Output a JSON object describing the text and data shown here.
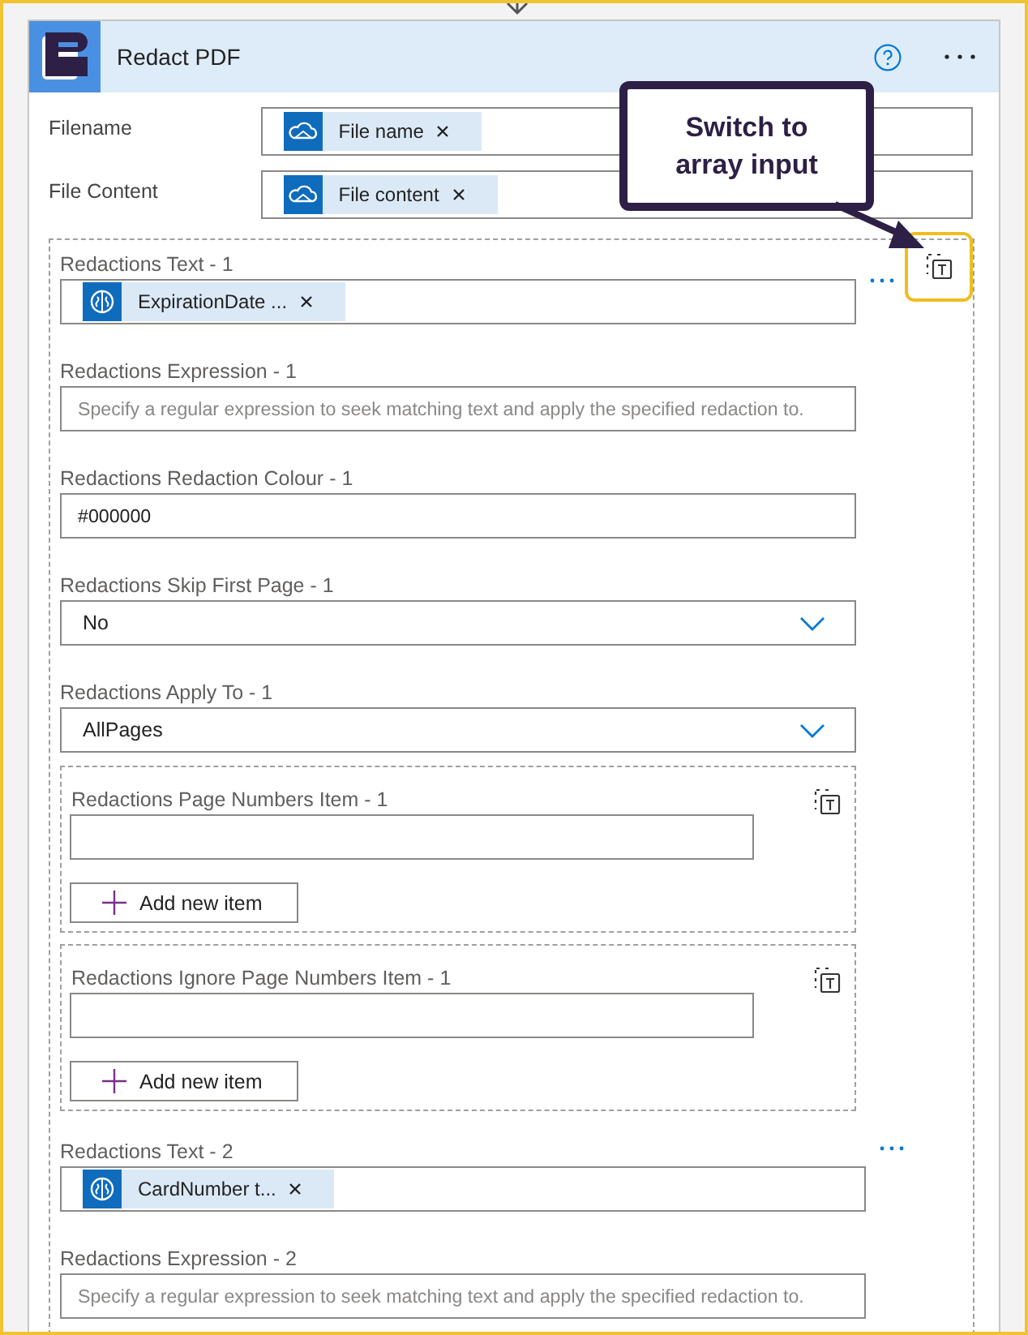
{
  "action": {
    "title": "Redact PDF"
  },
  "fields": [
    {
      "label": "Filename",
      "token": {
        "text": "File name",
        "kind": "onedrive"
      }
    },
    {
      "label": "File Content",
      "token": {
        "text": "File content",
        "kind": "onedrive"
      }
    }
  ],
  "redactions": [
    {
      "menu": true,
      "array_switch": true,
      "highlighted": true,
      "items": [
        {
          "kind": "token",
          "label": "Redactions Text - 1",
          "token": {
            "text": "ExpirationDate ...",
            "kind": "ai"
          }
        },
        {
          "kind": "text",
          "label": "Redactions Expression - 1",
          "placeholder": "Specify a regular expression to seek matching text and apply the specified redaction to."
        },
        {
          "kind": "text",
          "label": "Redactions Redaction Colour - 1",
          "value": "#000000"
        },
        {
          "kind": "dropdown",
          "label": "Redactions Skip First Page - 1",
          "value": "No"
        },
        {
          "kind": "dropdown",
          "label": "Redactions Apply To - 1",
          "value": "AllPages"
        },
        {
          "kind": "array",
          "label": "Redactions Page Numbers Item - 1",
          "button": "Add new item"
        },
        {
          "kind": "array",
          "label": "Redactions Ignore Page Numbers Item - 1",
          "button": "Add new item"
        }
      ]
    },
    {
      "menu": true,
      "array_switch": false,
      "highlighted": false,
      "items": [
        {
          "kind": "token",
          "label": "Redactions Text - 2",
          "token": {
            "text": "CardNumber t...",
            "kind": "ai"
          }
        },
        {
          "kind": "text",
          "label": "Redactions Expression - 2",
          "placeholder": "Specify a regular expression to seek matching text and apply the specified redaction to."
        }
      ]
    }
  ],
  "callout": {
    "text": "Switch to array input"
  }
}
